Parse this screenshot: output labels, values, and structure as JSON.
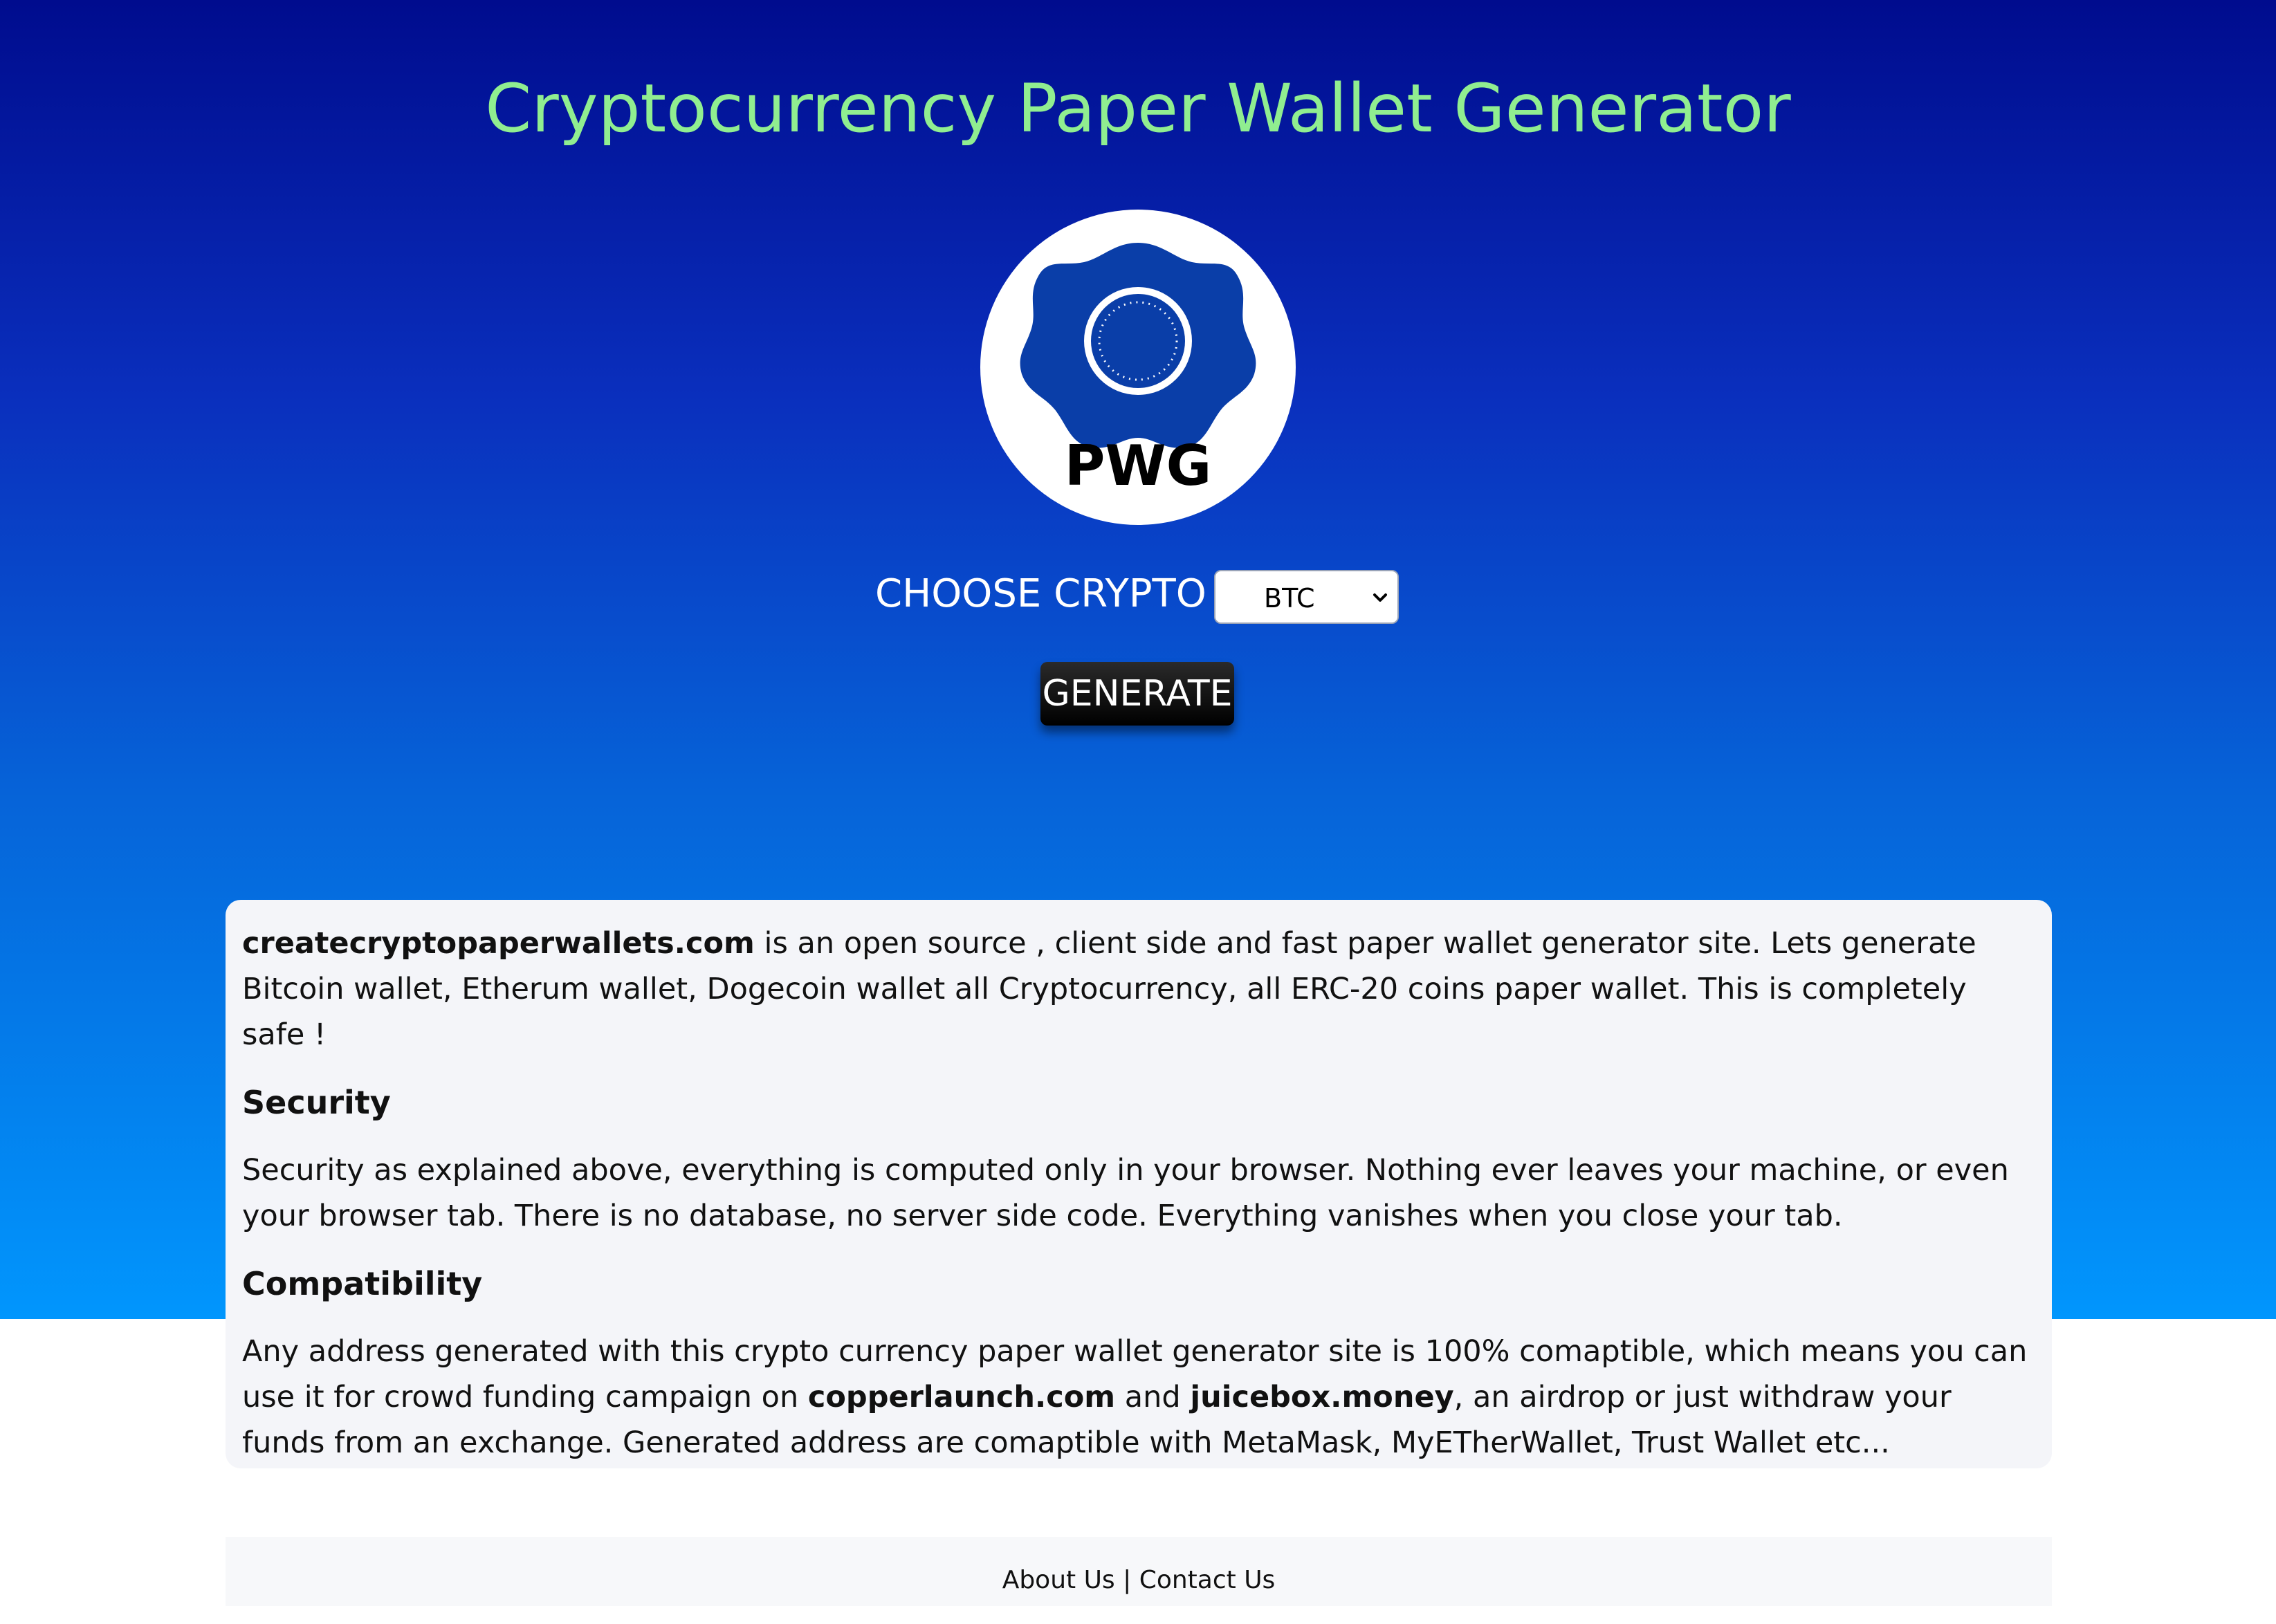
{
  "header": {
    "title": "Cryptocurrency Paper Wallet Generator"
  },
  "logo": {
    "text": "PWG"
  },
  "controls": {
    "choose_label": "CHOOSE CRYPTO",
    "selected_crypto": "BTC",
    "generate_label": "GENERATE"
  },
  "content": {
    "intro_site": "createcryptopaperwallets.com",
    "intro_text": " is an open source , client side and fast paper wallet generator site. Lets generate Bitcoin wallet, Etherum wallet, Dogecoin wallet all Cryptocurrency, all ERC-20 coins paper wallet. This is completely safe !",
    "security_heading": "Security",
    "security_text": "Security as explained above, everything is computed only in your browser. Nothing ever leaves your machine, or even your browser tab. There is no database, no server side code. Everything vanishes when you close your tab.",
    "compat_heading": "Compatibility",
    "compat_text_1": "Any address generated with this crypto currency paper wallet generator site is 100% comaptible, which means you can use it for crowd funding campaign on ",
    "compat_link_1": "copperlaunch.com",
    "compat_and": " and ",
    "compat_link_2": "juicebox.money",
    "compat_text_2": ", an airdrop or just withdraw your funds from an exchange. Generated address are comaptible with MetaMask, MyETherWallet, Trust Wallet etc..."
  },
  "footer": {
    "about": "About Us",
    "separator": " | ",
    "contact": "Contact Us"
  },
  "colors": {
    "title": "#90ee90",
    "logo_blue": "#0a3ea8",
    "hero_top": "#000c8e",
    "hero_bottom": "#0196fd"
  }
}
